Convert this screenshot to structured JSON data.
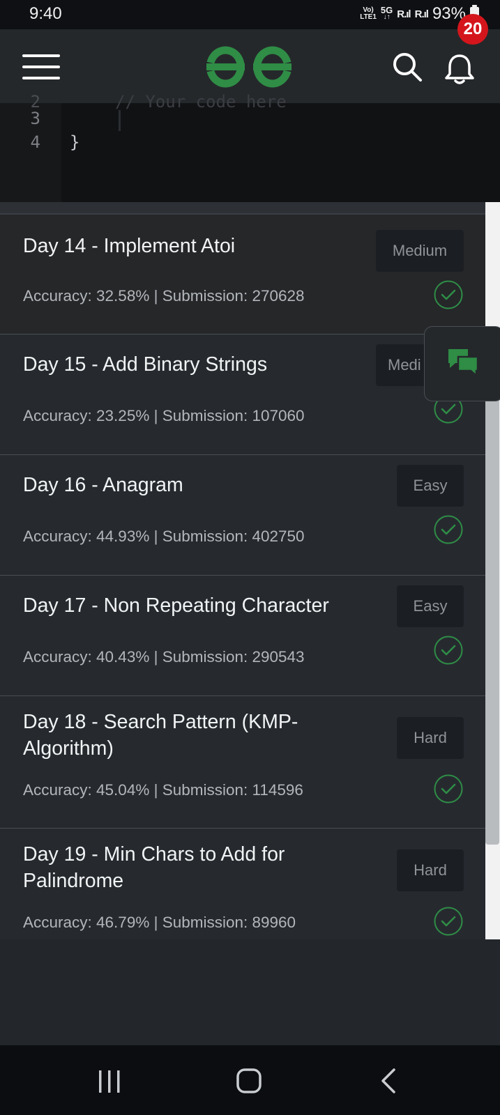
{
  "status_bar": {
    "time": "9:40",
    "network_top": "Vo)",
    "network_bottom": "LTE1",
    "net_type_top": "5G",
    "net_type_bottom": "↓↑",
    "sim1": "R.ıl",
    "sim2": "R.ıl",
    "battery": "93%"
  },
  "header": {
    "menu_icon": "hamburger-icon",
    "logo": "GfG",
    "search_icon": "search-icon",
    "notification_icon": "bell-icon",
    "notification_count": "20",
    "accent_color": "#2f8d46"
  },
  "editor": {
    "line_numbers": [
      "2",
      "3",
      "4"
    ],
    "lines": [
      "// Your code here",
      "",
      "}"
    ]
  },
  "problems": [
    {
      "title": "Day 14 - Implement Atoi",
      "difficulty": "Medium",
      "meta": "Accuracy: 32.58% | Submission: 270628",
      "solved": true
    },
    {
      "title": "Day 15 - Add Binary Strings",
      "difficulty": "Medi",
      "meta": "Accuracy: 23.25% | Submission: 107060",
      "solved": true
    },
    {
      "title": "Day 16 - Anagram",
      "difficulty": "Easy",
      "meta": "Accuracy: 44.93% | Submission: 402750",
      "solved": true
    },
    {
      "title": "Day 17 - Non Repeating Character",
      "difficulty": "Easy",
      "meta": "Accuracy: 40.43% | Submission: 290543",
      "solved": true
    },
    {
      "title": "Day 18 - Search Pattern (KMP-",
      "title_line2": "Algorithm)",
      "difficulty": "Hard",
      "meta": "Accuracy: 45.04% | Submission: 114596",
      "solved": true
    },
    {
      "title": "Day 19 - Min Chars to Add for",
      "title_line2": "Palindrome",
      "difficulty": "Hard",
      "meta": "Accuracy: 46.79% | Submission: 89960",
      "solved": true
    }
  ],
  "colors": {
    "solved_check": "#2f8d46",
    "notification_badge": "#d4161c"
  },
  "chat_button": {
    "icon": "chat-icon"
  },
  "nav_bar": {
    "recents_icon": "recents-icon",
    "home_icon": "home-icon",
    "back_icon": "back-icon"
  }
}
